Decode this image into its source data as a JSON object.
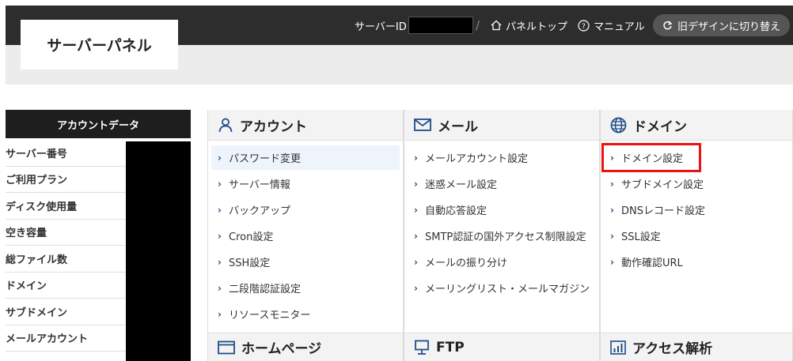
{
  "header": {
    "logo": "サーバーパネル",
    "server_id_label": "サーバーID",
    "separator": "/",
    "panel_top": "パネルトップ",
    "manual": "マニュアル",
    "old_design": "旧デザインに切り替え"
  },
  "sidebar": {
    "title": "アカウントデータ",
    "rows": [
      "サーバー番号",
      "ご利用プラン",
      "ディスク使用量",
      "空き容量",
      "総ファイル数",
      "ドメイン",
      "サブドメイン",
      "メールアカウント"
    ]
  },
  "sections": {
    "account": {
      "title": "アカウント",
      "items": [
        "パスワード変更",
        "サーバー情報",
        "バックアップ",
        "Cron設定",
        "SSH設定",
        "二段階認証設定",
        "リソースモニター"
      ]
    },
    "mail": {
      "title": "メール",
      "items": [
        "メールアカウント設定",
        "迷惑メール設定",
        "自動応答設定",
        "SMTP認証の国外アクセス制限設定",
        "メールの振り分け",
        "メーリングリスト・メールマガジン"
      ]
    },
    "domain": {
      "title": "ドメイン",
      "items": [
        "ドメイン設定",
        "サブドメイン設定",
        "DNSレコード設定",
        "SSL設定",
        "動作確認URL"
      ]
    },
    "homepage": {
      "title": "ホームページ"
    },
    "ftp": {
      "title": "FTP"
    },
    "analytics": {
      "title": "アクセス解析"
    }
  },
  "colors": {
    "topbar": "#2d2d2d",
    "accent": "#1d4e89",
    "highlight": "#e11111"
  }
}
